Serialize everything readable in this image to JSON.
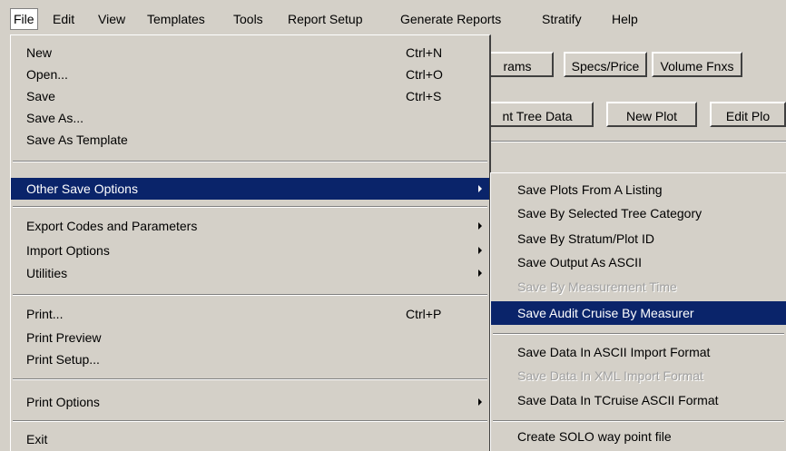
{
  "menubar": {
    "items": [
      "File",
      "Edit",
      "View",
      "Templates",
      "Tools",
      "Report Setup",
      "Generate Reports",
      "Stratify",
      "Help"
    ]
  },
  "toolbar": {
    "row1": [
      "rams",
      "Specs/Price",
      "Volume Fnxs"
    ],
    "row2": [
      "nt Tree Data",
      "New Plot",
      "Edit Plo"
    ]
  },
  "file_menu": {
    "items": [
      {
        "label": "New",
        "shortcut": "Ctrl+N"
      },
      {
        "label": "Open...",
        "shortcut": "Ctrl+O"
      },
      {
        "label": "Save",
        "shortcut": "Ctrl+S"
      },
      {
        "label": "Save  As..."
      },
      {
        "label": "Save As Template"
      },
      {
        "label": "Other Save Options"
      },
      {
        "label": "Export  Codes and Parameters"
      },
      {
        "label": "Import Options"
      },
      {
        "label": "Utilities"
      },
      {
        "label": "Print...",
        "shortcut": "Ctrl+P"
      },
      {
        "label": "Print Preview"
      },
      {
        "label": "Print Setup..."
      },
      {
        "label": "Print Options"
      },
      {
        "label": "Exit"
      }
    ]
  },
  "save_submenu": {
    "items": [
      {
        "label": "Save Plots From A Listing"
      },
      {
        "label": "Save By Selected Tree Category"
      },
      {
        "label": "Save By Stratum/Plot ID"
      },
      {
        "label": "Save Output As ASCII"
      },
      {
        "label": "Save By Measurement Time",
        "disabled": true
      },
      {
        "label": "Save Audit Cruise By Measurer"
      },
      {
        "label": "Save Data In  ASCII Import Format"
      },
      {
        "label": "Save Data In XML Import Format",
        "disabled": true
      },
      {
        "label": "Save Data In TCruise ASCII Format"
      },
      {
        "label": "Create SOLO way point file"
      }
    ]
  },
  "colors": {
    "menu_bg": "#d4d0c8",
    "highlight": "#0a246a",
    "highlight_text": "#ffffff",
    "disabled": "#a0a0a0"
  }
}
